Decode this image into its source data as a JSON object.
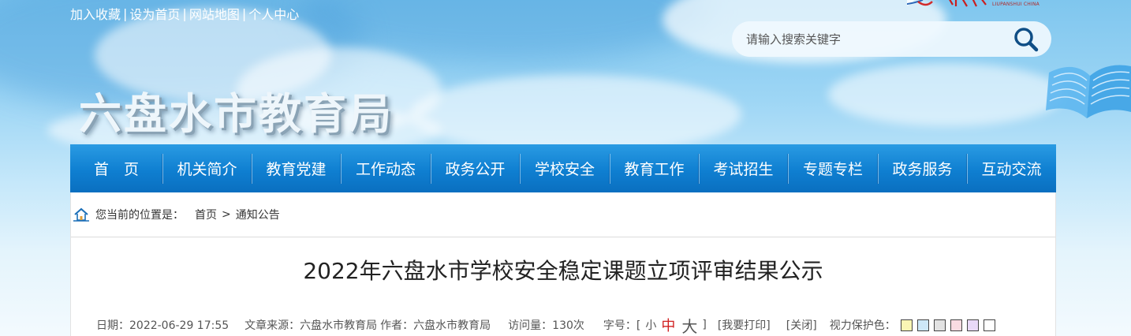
{
  "top_links": [
    "加入收藏",
    "设为首页",
    "网站地图",
    "个人中心"
  ],
  "top_link_separator": "|",
  "logo": {
    "en_text": "LIUPANSHUI CHINA",
    "icon": "city-logo-icon"
  },
  "search": {
    "placeholder": "请输入搜索关键字",
    "button_icon": "search-icon"
  },
  "site_title": "六盘水市教育局",
  "nav": [
    "首　页",
    "机关简介",
    "教育党建",
    "工作动态",
    "政务公开",
    "学校安全",
    "教育工作",
    "考试招生",
    "专题专栏",
    "政务服务",
    "互动交流"
  ],
  "breadcrumb": {
    "icon": "home-icon",
    "label": "您当前的位置是：",
    "items": [
      "首页",
      "通知公告"
    ],
    "separator": ">"
  },
  "article": {
    "title": "2022年六盘水市学校安全稳定课题立项评审结果公示",
    "date": "日期：2022-06-29 17:55",
    "source": "文章来源：六盘水市教育局",
    "author": "作者：六盘水市教育局",
    "visits": "访问量：130次",
    "font_size_label": "字号：[",
    "font_size_small": "小",
    "font_size_mid": "中",
    "font_size_big": "大",
    "font_size_close": "]",
    "print": "[我要打印]",
    "close": "[关闭]",
    "eye_care_label": "视力保护色："
  },
  "eye_care_colors": [
    "#faf6b4",
    "#cde8f8",
    "#e2e2e2",
    "#f9dbe2",
    "#e9d9f8",
    "#ffffff"
  ],
  "colors": {
    "nav_bg": "#0f7fd1",
    "font_mid_active": "#d12020",
    "link_text": "#ffffff"
  }
}
